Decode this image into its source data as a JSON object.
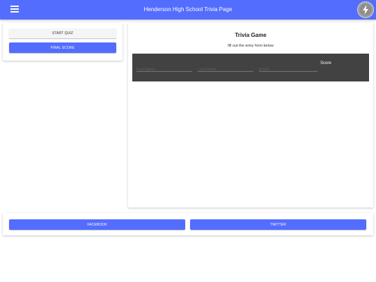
{
  "header": {
    "title": "Henderson High School Trivia Page",
    "menu_icon": "hamburger-menu-icon",
    "avatar_icon": "lightning-bolt-icon",
    "bar_color": "#536dfe"
  },
  "sidebar": {
    "start_label": "START QUIZ",
    "final_label": "FINAL SCORE"
  },
  "game": {
    "title": "Trivia Game",
    "subtitle": "fill out the entry form below",
    "first_name_placeholder": "First Name",
    "last_name_placeholder": "Last Name",
    "email_placeholder": "Email",
    "first_name_value": "",
    "last_name_value": "",
    "email_value": "",
    "score_label": "Score"
  },
  "footer": {
    "facebook_label": "FACEBOOK",
    "twitter_label": "TWITTER"
  }
}
